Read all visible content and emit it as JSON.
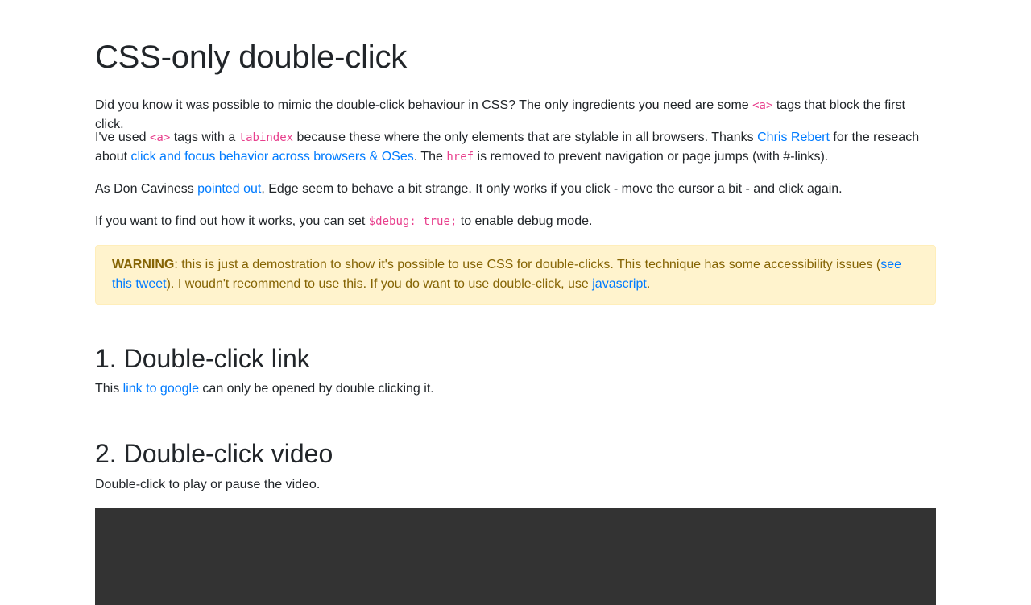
{
  "page": {
    "title": "CSS-only double-click"
  },
  "intro": {
    "p1": {
      "before": "Did you know it was possible to mimic the double-click behaviour in CSS? The only ingredients you need are some ",
      "code": "<a>",
      "after": " tags that block the first click."
    },
    "p2": {
      "t1": "I've used ",
      "code1": "<a>",
      "t2": " tags with a ",
      "code2": "tabindex",
      "t3": " because these where the only elements that are stylable in all browsers. Thanks ",
      "link1": "Chris Rebert",
      "t4": " for the reseach about ",
      "link2": "click and focus behavior across browsers & OSes",
      "t5": ". The ",
      "code3": "href",
      "t6": " is removed to prevent navigation or page jumps (with #-links)."
    },
    "p3": {
      "t1": "As Don Caviness ",
      "link": "pointed out",
      "t2": ", Edge seem to behave a bit strange. It only works if you click - move the cursor a bit - and click again."
    },
    "p4": {
      "t1": "If you want to find out how it works, you can set ",
      "code": "$debug: true;",
      "t2": " to enable debug mode."
    }
  },
  "warning": {
    "label": "WARNING",
    "t1": ": this is just a demostration to show it's possible to use CSS for double-clicks. This technique has some accessibility issues (",
    "link1": "see this tweet",
    "t2": "). I woudn't recommend to use this. If you do want to use double-click, use ",
    "link2": "javascript",
    "t3": "."
  },
  "section1": {
    "heading": "1. Double-click link",
    "t1": "This ",
    "link": "link to google",
    "t2": " can only be opened by double clicking it."
  },
  "section2": {
    "heading": "2. Double-click video",
    "text": "Double-click to play or pause the video."
  },
  "colors": {
    "link": "#007bff",
    "code": "#e83e8c",
    "warning_bg": "#fff3cd",
    "warning_text": "#856404",
    "video_bg": "#333333"
  }
}
